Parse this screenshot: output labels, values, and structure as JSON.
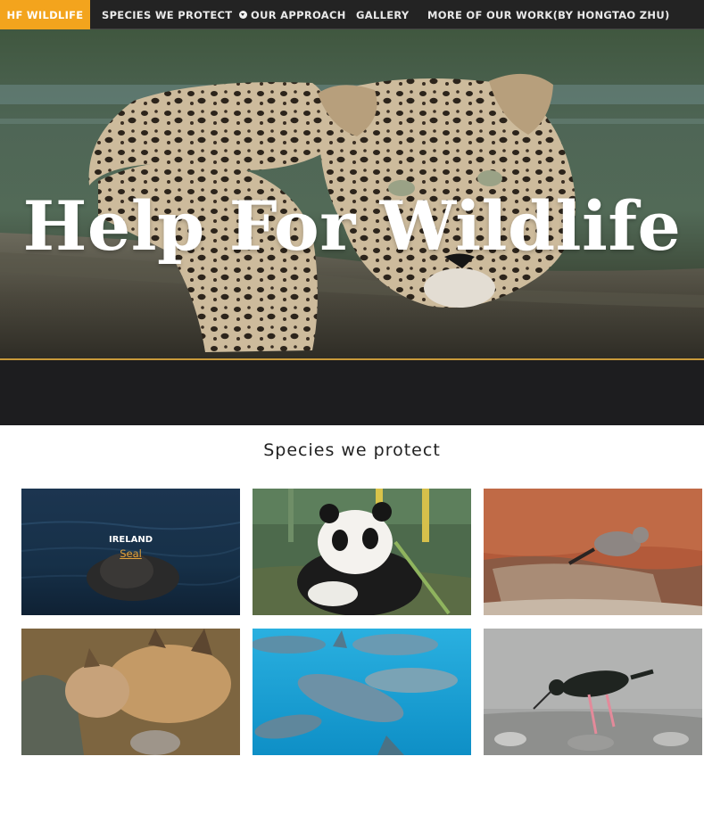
{
  "nav": {
    "brand": "HF WILDLIFE",
    "items": [
      {
        "label": "SPECIES WE PROTECT",
        "has_dropdown": true
      },
      {
        "label": "OUR APPROACH"
      },
      {
        "label": "GALLERY"
      },
      {
        "label": "MORE OF OUR WORK(BY HONGTAO ZHU)"
      }
    ]
  },
  "hero": {
    "title": "Help For Wildlife"
  },
  "species_section": {
    "title": "Species we protect",
    "cards": [
      {
        "country": "IRELAND",
        "name": "Seal",
        "image": "seal-photo"
      },
      {
        "image": "panda-photo"
      },
      {
        "image": "wallaby-photo"
      },
      {
        "image": "lynx-photo"
      },
      {
        "image": "dolphin-photo"
      },
      {
        "image": "wading-bird-photo"
      }
    ]
  },
  "colors": {
    "accent": "#f3a41d",
    "nav_bg": "#232323",
    "band_bg": "#1d1d1f",
    "link": "#e3a23a"
  }
}
